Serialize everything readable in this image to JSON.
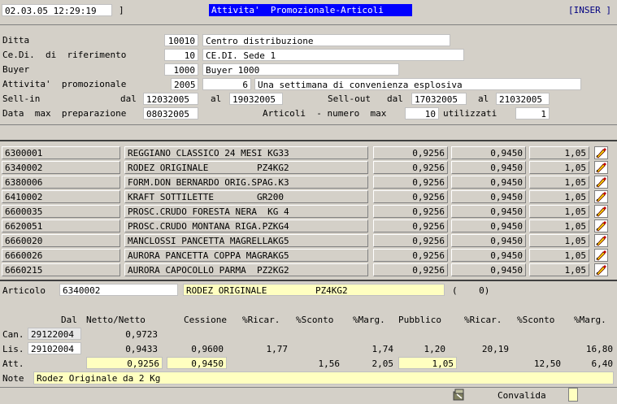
{
  "header": {
    "datetime": "02.03.05 12:29:19",
    "bracket": "]",
    "title": "Attivita'  Promozionale-Articoli",
    "mode": "[INSER ]"
  },
  "form": {
    "ditta_label": "Ditta",
    "ditta_code": "10010",
    "ditta_name": "Centro distribuzione",
    "cedi_label": "Ce.Di.  di  riferimento",
    "cedi_code": "10",
    "cedi_name": "CE.DI. Sede 1",
    "buyer_label": "Buyer",
    "buyer_code": "1000",
    "buyer_name": "Buyer 1000",
    "att_label": "Attivita'  promozionale",
    "att_year": "2005",
    "att_num": "6",
    "att_desc": "Una settimana di convenienza esplosiva",
    "sellin_label": "Sell-in",
    "dal_label": "dal",
    "sellin_from": "12032005",
    "al_label": "al",
    "sellin_to": "19032005",
    "sellout_label": "Sell-out",
    "dal2_label": "dal",
    "sellout_from": "17032005",
    "al2_label": "al",
    "sellout_to": "21032005",
    "datamax_label": "Data  max  preparazione",
    "datamax": "08032005",
    "articoli_label": "Articoli  - numero  max",
    "articoli_max": "10",
    "utilizzati_label": "utilizzati",
    "utilizzati": "1"
  },
  "grid": {
    "rows": [
      {
        "code": "6300001",
        "desc": "REGGIANO CLASSICO 24 MESI KG33",
        "v1": "0,9256",
        "v2": "0,9450",
        "v3": "1,05"
      },
      {
        "code": "6340002",
        "desc": "RODEZ ORIGINALE         PZ4KG2",
        "v1": "0,9256",
        "v2": "0,9450",
        "v3": "1,05"
      },
      {
        "code": "6380006",
        "desc": "FORM.DON BERNARDO ORIG.SPAG.K3",
        "v1": "0,9256",
        "v2": "0,9450",
        "v3": "1,05"
      },
      {
        "code": "6410002",
        "desc": "KRAFT SOTTILETTE        GR200",
        "v1": "0,9256",
        "v2": "0,9450",
        "v3": "1,05"
      },
      {
        "code": "6600035",
        "desc": "PROSC.CRUDO FORESTA NERA  KG 4",
        "v1": "0,9256",
        "v2": "0,9450",
        "v3": "1,05"
      },
      {
        "code": "6620051",
        "desc": "PROSC.CRUDO MONTANA RIGA.PZKG4",
        "v1": "0,9256",
        "v2": "0,9450",
        "v3": "1,05"
      },
      {
        "code": "6660020",
        "desc": "MANCLOSSI PANCETTA MAGRELLAKG5",
        "v1": "0,9256",
        "v2": "0,9450",
        "v3": "1,05"
      },
      {
        "code": "6660026",
        "desc": "AURORA PANCETTA COPPA MAGRAKG5",
        "v1": "0,9256",
        "v2": "0,9450",
        "v3": "1,05"
      },
      {
        "code": "6660215",
        "desc": "AURORA CAPOCOLLO PARMA  PZ2KG2",
        "v1": "0,9256",
        "v2": "0,9450",
        "v3": "1,05"
      }
    ]
  },
  "detail": {
    "articolo_label": "Articolo",
    "articolo_code": "6340002",
    "articolo_desc": "RODEZ ORIGINALE         PZ4KG2",
    "articolo_count": "(    0)",
    "headers": {
      "dal": "Dal",
      "netto": "Netto/Netto",
      "cessione": "Cessione",
      "ricar1": "%Ricar.",
      "sconto1": "%Sconto",
      "marg1": "%Marg.",
      "pubblico": "Pubblico",
      "ricar2": "%Ricar.",
      "sconto2": "%Sconto",
      "marg2": "%Marg."
    },
    "can": {
      "label": "Can.",
      "dal": "29122004",
      "netto": "0,9723"
    },
    "lis": {
      "label": "Lis.",
      "dal": "29102004",
      "netto": "0,9433",
      "cessione": "0,9600",
      "ricar1": "1,77",
      "marg1": "1,74",
      "pubblico": "1,20",
      "ricar2": "20,19",
      "marg2": "16,80"
    },
    "att": {
      "label": "Att.",
      "netto": "0,9256",
      "cessione": "0,9450",
      "sconto1": "1,56",
      "marg1": "2,05",
      "pubblico": "1,05",
      "sconto2": "12,50",
      "marg2": "6,40"
    },
    "note_label": "Note",
    "note": "Rodez Originale da 2 Kg"
  },
  "footer": {
    "convalida_label": "Convalida"
  },
  "colors": {
    "title_bg": "#0000ff",
    "field_yellow": "#ffffc0",
    "window_bg": "#d4d0c8"
  }
}
